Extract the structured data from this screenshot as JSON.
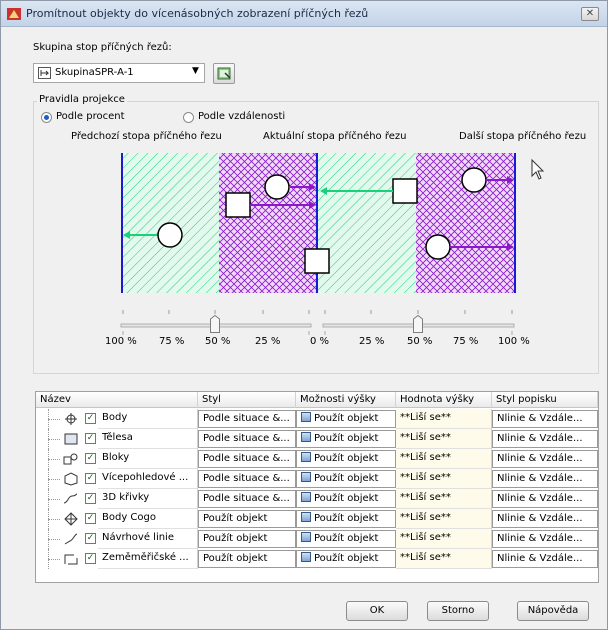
{
  "window": {
    "title": "Promítnout objekty do vícenásobných zobrazení příčných řezů",
    "close_label": "✕"
  },
  "group_label": "Skupina stop příčných řezů:",
  "group_combo": {
    "value": "SkupinaSPR-A-1"
  },
  "rules": {
    "title": "Pravidla projekce",
    "option_percent": "Podle procent",
    "option_distance": "Podle vzdálenosti",
    "selected": "Podle procent"
  },
  "diagram": {
    "label_prev": "Předchozí stopa příčného řezu",
    "label_current": "Aktuální stopa příčného řezu",
    "label_next": "Další stopa příčného řezu",
    "colors": {
      "green": "#16d37a",
      "purple": "#8a19c8",
      "blue": "#1a1ad6",
      "fill_green": "#dcf7e9",
      "fill_purple": "#e8cdf5"
    },
    "ticks_left": [
      "100 %",
      "75 %",
      "50 %",
      "25 %",
      "0 %"
    ],
    "ticks_right": [
      "25 %",
      "50 %",
      "75 %",
      "100 %"
    ],
    "slider_left_pct": 50,
    "slider_right_pct": 50
  },
  "grid": {
    "headers": [
      "Název",
      "Styl",
      "Možnosti výšky",
      "Hodnota výšky",
      "Styl popisku"
    ],
    "rows": [
      {
        "icon": "point-icon",
        "name": "Body",
        "style": "Podle situace &...",
        "height_opt": "Použít objekt",
        "height_val": "**Liší se**",
        "label_style": "Nlinie & Vzdále..."
      },
      {
        "icon": "solid-icon",
        "name": "Tělesa",
        "style": "Podle situace &...",
        "height_opt": "Použít objekt",
        "height_val": "**Liší se**",
        "label_style": "Nlinie & Vzdále..."
      },
      {
        "icon": "block-icon",
        "name": "Bloky",
        "style": "Podle situace &...",
        "height_opt": "Použít objekt",
        "height_val": "**Liší se**",
        "label_style": "Nlinie & Vzdále..."
      },
      {
        "icon": "multiview-icon",
        "name": "Vícepohledové ...",
        "style": "Podle situace &...",
        "height_opt": "Použít objekt",
        "height_val": "**Liší se**",
        "label_style": "Nlinie & Vzdále..."
      },
      {
        "icon": "3d-curve-icon",
        "name": "3D křivky",
        "style": "Podle situace &...",
        "height_opt": "Použít objekt",
        "height_val": "**Liší se**",
        "label_style": "Nlinie & Vzdále..."
      },
      {
        "icon": "cogo-point-icon",
        "name": "Body Cogo",
        "style": "Použít objekt",
        "height_opt": "Použít objekt",
        "height_val": "**Liší se**",
        "label_style": "Nlinie & Vzdále..."
      },
      {
        "icon": "feature-line-icon",
        "name": "Návrhové linie",
        "style": "Použít objekt",
        "height_opt": "Použít objekt",
        "height_val": "**Liší se**",
        "label_style": "Nlinie & Vzdále..."
      },
      {
        "icon": "survey-figure-icon",
        "name": "Zeměměřičské ...",
        "style": "Použít objekt",
        "height_opt": "Použít objekt",
        "height_val": "**Liší se**",
        "label_style": "Nlinie & Vzdále..."
      }
    ]
  },
  "buttons": {
    "ok": "OK",
    "cancel": "Storno",
    "help": "Nápověda"
  }
}
